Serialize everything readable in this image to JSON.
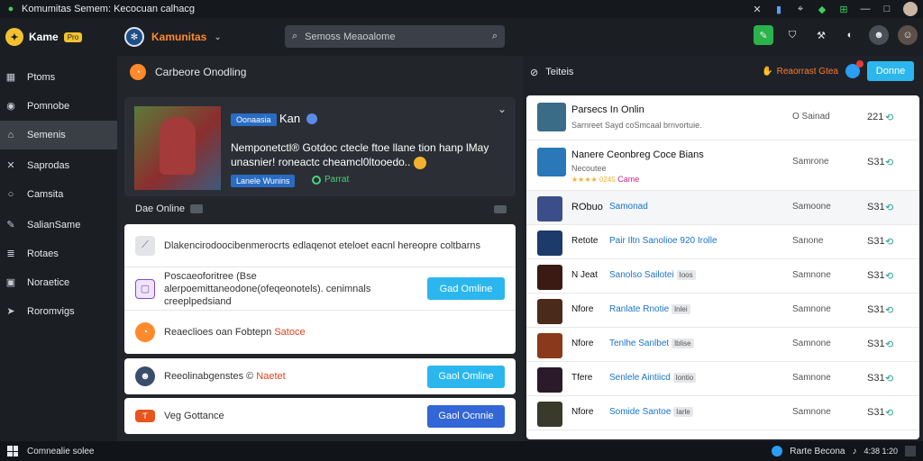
{
  "window": {
    "title": "Komumitas Semem: Kecocuan calhacg"
  },
  "app": {
    "brand_name": "Kame",
    "brand_badge": "Pro",
    "community_name": "Kamunitas",
    "search_placeholder": "Semoss Meaoalome"
  },
  "sidebar": {
    "items": [
      {
        "label": "Ptoms",
        "icon": "grid-icon"
      },
      {
        "label": "Pomnobe",
        "icon": "circle-icon"
      },
      {
        "label": "Semenis",
        "icon": "home-icon"
      },
      {
        "label": "Saprodas",
        "icon": "cross-icon"
      },
      {
        "label": "Camsita",
        "icon": "circle-icon"
      },
      {
        "label": "SalianSame",
        "icon": "edit-icon"
      },
      {
        "label": "Rotaes",
        "icon": "list-icon"
      },
      {
        "label": "Noraetice",
        "icon": "folder-icon"
      },
      {
        "label": "Roromvigs",
        "icon": "send-icon"
      }
    ]
  },
  "main": {
    "section_title": "Carbeore Onodling",
    "feature": {
      "tag": "Oonaasia",
      "name": "Kan",
      "description": "Nemponetctl® Gotdoc ctecle ftoe llane tion hanp lMay unasnier! roneactc cheamcl0ltooedo..",
      "tag2": "Lanele Wunins",
      "status": "Parrat"
    },
    "subheader": "Dae Online",
    "rows": [
      {
        "text": "Dlakencirodoocibenmerocrts edlaqenot eteloet eacnl hereopre coltbarns"
      },
      {
        "text": "Poscaeoforitree (Bse alerpoemittaneodone(ofeqeonotels). cenimnals creeplpedsiand",
        "button": "Gad Omline"
      },
      {
        "text": "Reaeclioes oan Fobtepn",
        "accent": "Satoce"
      }
    ],
    "rows2": [
      {
        "text": "Reeolinabgenstes ©",
        "accent": "Naetet",
        "button": "Gaol Omline"
      },
      {
        "text": "Veg Gottance",
        "button": "Gaol Ocnnie"
      }
    ]
  },
  "panel": {
    "title": "Teiteis",
    "report": "Reaorrast Gtea",
    "done_label": "Donne",
    "items": [
      {
        "title": "Parsecs In Onlin",
        "subtitle": "Sarnreet Sayd coSmcaal brnvortuie.",
        "status": "O Sainad",
        "num": "221"
      },
      {
        "title": "Nanere Ceonbreg Coce Bians",
        "subtitle": "Necoutee",
        "rating": "★★★★ 0245",
        "extra": "Came",
        "status": "Samrone",
        "num": "S31"
      },
      {
        "title": "RObuo",
        "link": "Samonad",
        "status": "Samoone",
        "num": "S31"
      },
      {
        "title": "Retote",
        "link": "Pair Iltn Sanolioe  920 Irolle",
        "status": "Sanone",
        "num": "S31"
      },
      {
        "title": "N Jeat",
        "link": "Sanolso  Sailotei",
        "tag": "Ioos",
        "status": "Samnone",
        "num": "S31"
      },
      {
        "title": "Nfore",
        "link": "Ranlate  Rnotie",
        "tag": "Inlei",
        "status": "Samnone",
        "num": "S31"
      },
      {
        "title": "Nfore",
        "link": "Tenlhe  Sanlbet",
        "tag": "Iblise",
        "status": "Samnone",
        "num": "S31"
      },
      {
        "title": "Tfere",
        "link": "Senlele  Aintiicd",
        "tag": "Iontio",
        "status": "Samnone",
        "num": "S31"
      },
      {
        "title": "Nfore",
        "link": "Somide  Santoe",
        "tag": "Iarle",
        "status": "Samnone",
        "num": "S31"
      }
    ]
  },
  "taskbar": {
    "left": "Comnealie solee",
    "right": "Rarte  Becona",
    "clock": "4:38 1:20"
  }
}
